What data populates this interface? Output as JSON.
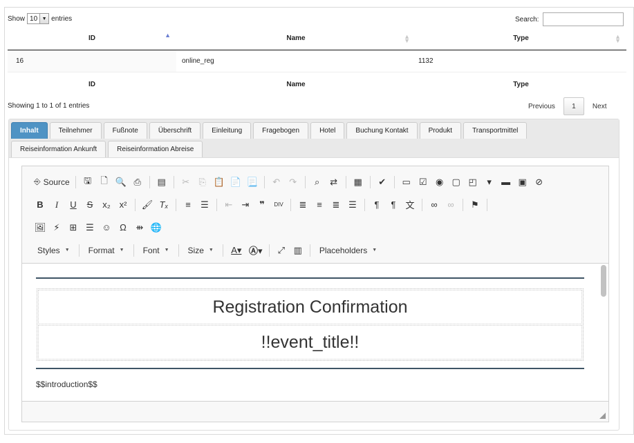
{
  "datatable": {
    "show_label": "Show",
    "length_value": "10",
    "entries_label": "entries",
    "search_label": "Search:",
    "search_value": "",
    "columns": [
      "ID",
      "Name",
      "Type"
    ],
    "rows": [
      [
        "16",
        "online_reg",
        "1132"
      ]
    ],
    "footer_columns": [
      "ID",
      "Name",
      "Type"
    ],
    "info": "Showing 1 to 1 of 1 entries",
    "pager": {
      "previous": "Previous",
      "current": "1",
      "next": "Next"
    }
  },
  "tabs": [
    "Inhalt",
    "Teilnehmer",
    "Fußnote",
    "Überschrift",
    "Einleitung",
    "Fragebogen",
    "Hotel",
    "Buchung Kontakt",
    "Produkt",
    "Transportmittel",
    "Reiseinformation Ankunft",
    "Reiseinformation Abreise"
  ],
  "active_tab": "Inhalt",
  "editor": {
    "source_label": "Source",
    "combos": {
      "styles": "Styles",
      "format": "Format",
      "font": "Font",
      "size": "Size",
      "placeholders": "Placeholders"
    },
    "content": {
      "heading": "Registration Confirmation",
      "event_title": "!!event_title!!",
      "introduction": "$$introduction$$"
    }
  },
  "icons": {
    "row1": [
      "source-icon",
      "save-icon",
      "new-page-icon",
      "preview-icon",
      "print-icon",
      "templates-icon",
      "cut-icon",
      "copy-icon",
      "paste-icon",
      "paste-text-icon",
      "paste-word-icon",
      "undo-icon",
      "redo-icon",
      "find-icon",
      "replace-icon",
      "select-all-icon",
      "spellcheck-icon",
      "form-icon",
      "checkbox-icon",
      "radio-icon",
      "textfield-icon",
      "textarea-icon",
      "select-icon",
      "button-icon",
      "image-button-icon",
      "hidden-field-icon"
    ],
    "row2": [
      "bold-icon",
      "italic-icon",
      "underline-icon",
      "strike-icon",
      "subscript-icon",
      "superscript-icon",
      "copy-format-icon",
      "remove-format-icon",
      "numbered-list-icon",
      "bulleted-list-icon",
      "outdent-icon",
      "indent-icon",
      "blockquote-icon",
      "div-icon",
      "align-left-icon",
      "align-center-icon",
      "align-right-icon",
      "justify-icon",
      "ltr-icon",
      "rtl-icon",
      "language-icon",
      "link-icon",
      "unlink-icon",
      "anchor-icon"
    ],
    "row3": [
      "image-icon",
      "flash-icon",
      "table-icon",
      "horizontal-rule-icon",
      "smiley-icon",
      "special-char-icon",
      "page-break-icon",
      "iframe-icon"
    ]
  }
}
